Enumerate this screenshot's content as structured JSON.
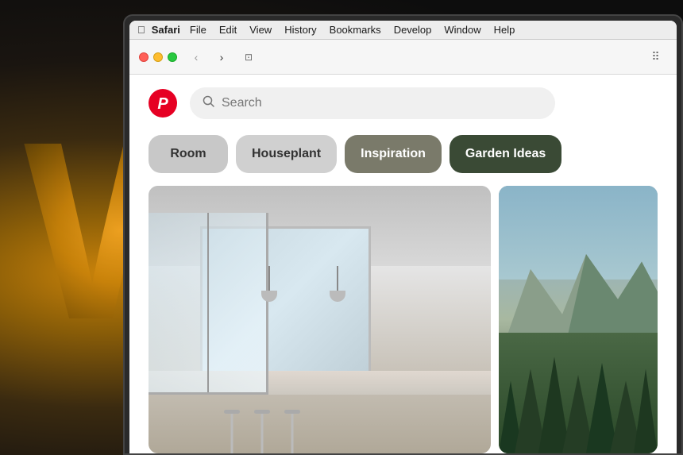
{
  "background": {
    "letter": "W"
  },
  "menubar": {
    "apple_icon": "⌘",
    "app_name": "Safari",
    "items": [
      {
        "label": "File",
        "active": false
      },
      {
        "label": "Edit",
        "active": false
      },
      {
        "label": "View",
        "active": false
      },
      {
        "label": "History",
        "active": false
      },
      {
        "label": "Bookmarks",
        "active": false
      },
      {
        "label": "Develop",
        "active": false
      },
      {
        "label": "Window",
        "active": false
      },
      {
        "label": "Help",
        "active": false
      }
    ]
  },
  "toolbar": {
    "back_icon": "‹",
    "forward_icon": "›",
    "tab_icon": "⊡",
    "share_icon": "⋯"
  },
  "pinterest": {
    "logo_letter": "P",
    "search_placeholder": "Search",
    "categories": [
      {
        "label": "Room",
        "style": "room"
      },
      {
        "label": "Houseplant",
        "style": "houseplant"
      },
      {
        "label": "Inspiration",
        "style": "inspiration"
      },
      {
        "label": "Garden Ideas",
        "style": "garden"
      }
    ]
  }
}
